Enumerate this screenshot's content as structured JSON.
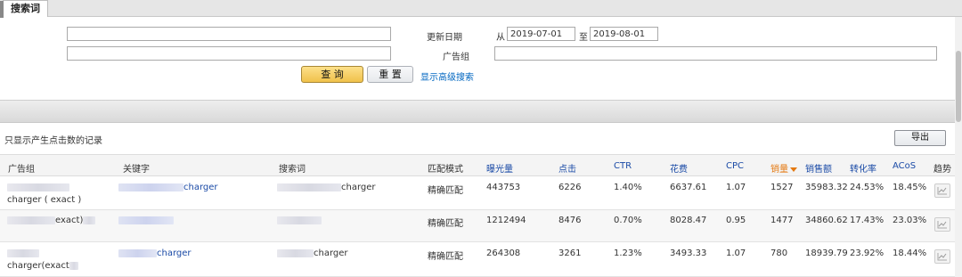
{
  "tab": {
    "label": "搜索词"
  },
  "filters": {
    "date_label": "更新日期",
    "from_label": "从",
    "from_value": "2019-07-01",
    "to_label": "至",
    "to_value": "2019-08-01",
    "adgroup_label": "广告组",
    "query_button": "查 询",
    "reset_button": "重 置",
    "advanced_link": "显示高级搜索"
  },
  "list": {
    "only_clicks_label": "只显示产生点击数的记录",
    "export_button": "导出"
  },
  "table": {
    "headers": [
      "广告组",
      "关键字",
      "搜索词",
      "匹配模式",
      "曝光量",
      "点击",
      "CTR",
      "花费",
      "CPC",
      "销量",
      "销售额",
      "转化率",
      "ACoS",
      "趋势"
    ],
    "rows": [
      {
        "adgroup": "charger ( exact )",
        "keyword": "charger",
        "search_term": "charger",
        "match": "精确匹配",
        "impressions": "443753",
        "clicks": "6226",
        "ctr": "1.40%",
        "spend": "6637.61",
        "cpc": "1.07",
        "orders": "1527",
        "sales": "35983.32",
        "conversion": "24.53%",
        "acos": "18.45%"
      },
      {
        "adgroup": "exact)",
        "keyword": "",
        "search_term": "",
        "match": "精确匹配",
        "impressions": "1212494",
        "clicks": "8476",
        "ctr": "0.70%",
        "spend": "8028.47",
        "cpc": "0.95",
        "orders": "1477",
        "sales": "34860.62",
        "conversion": "17.43%",
        "acos": "23.03%"
      },
      {
        "adgroup": "charger(exact",
        "keyword": "charger",
        "search_term": "charger",
        "match": "精确匹配",
        "impressions": "264308",
        "clicks": "3261",
        "ctr": "1.23%",
        "spend": "3493.33",
        "cpc": "1.07",
        "orders": "780",
        "sales": "18939.79",
        "conversion": "23.92%",
        "acos": "18.44%"
      }
    ]
  },
  "colors": {
    "link": "#1a4aa6",
    "sort_active": "#e47911",
    "query_button": "#f0c14b"
  },
  "icons": {
    "trend": "line-chart-icon",
    "sort": "sort-desc-icon"
  }
}
